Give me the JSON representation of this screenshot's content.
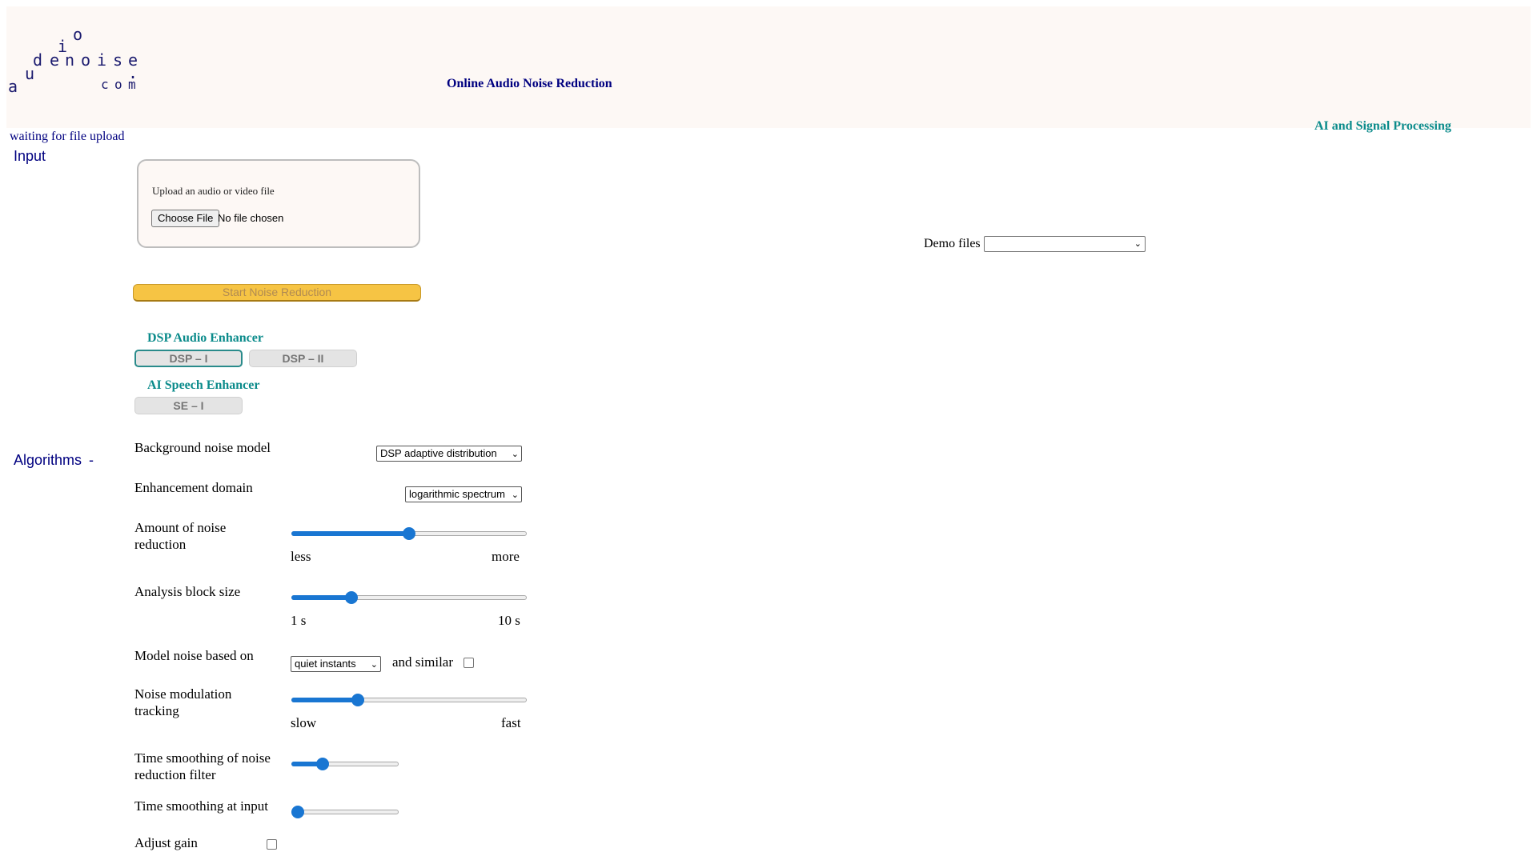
{
  "header": {
    "logo": {
      "chars": [
        "a",
        "u",
        "d",
        "i",
        "o",
        "e",
        "n",
        "o",
        "i",
        "s",
        "e",
        ".",
        "c",
        "o",
        "m"
      ]
    },
    "title": "Online Audio Noise Reduction",
    "tagline": "AI and Signal Processing"
  },
  "status": "waiting for file upload",
  "input_section": {
    "label": "Input",
    "upload_label": "Upload an audio or video file",
    "choose_file_label": "Choose File",
    "file_status": "No file chosen",
    "demo_label": "Demo files",
    "demo_selected": "",
    "start_label": "Start Noise Reduction"
  },
  "algorithms": {
    "label": "Algorithms",
    "collapse_symbol": "-",
    "dsp_title": "DSP Audio Enhancer",
    "dsp1": "DSP – I",
    "dsp2": "DSP – II",
    "ai_title": "AI Speech Enhancer",
    "se1": "SE – I"
  },
  "params": {
    "background_noise_model": {
      "label": "Background noise model",
      "value": "DSP adaptive distribution"
    },
    "enhancement_domain": {
      "label": "Enhancement domain",
      "value": "logarithmic spectrum"
    },
    "amount_noise_reduction": {
      "label_line1": "Amount of noise",
      "label_line2": "reduction",
      "min_label": "less",
      "max_label": "more",
      "level": 0.5
    },
    "analysis_block_size": {
      "label": "Analysis block size",
      "min_label": "1 s",
      "max_label": "10 s",
      "level": 0.24
    },
    "model_noise": {
      "label": "Model noise based on",
      "value": "quiet instants",
      "similar_label": "and similar",
      "similar_checked": false
    },
    "noise_modulation": {
      "label_line1": "Noise modulation",
      "label_line2": "tracking",
      "min_label": "slow",
      "max_label": "fast",
      "level": 0.27
    },
    "time_smoothing_filter": {
      "label_line1": "Time smoothing of noise",
      "label_line2": "reduction filter",
      "level": 0.26
    },
    "time_smoothing_input": {
      "label": "Time smoothing at input",
      "level": 0.0
    },
    "adjust_gain": {
      "label": "Adjust gain",
      "checked": false
    }
  }
}
